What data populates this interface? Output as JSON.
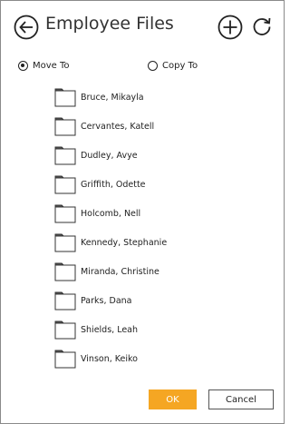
{
  "header": {
    "title": "Employee Files",
    "back_icon": "arrow-left-circle-icon",
    "add_icon": "plus-circle-icon",
    "refresh_icon": "refresh-icon"
  },
  "options": {
    "move_label": "Move To",
    "copy_label": "Copy To",
    "selected": "move"
  },
  "folders": [
    {
      "label": "Bruce, Mikayla"
    },
    {
      "label": "Cervantes, Katell"
    },
    {
      "label": "Dudley, Avye"
    },
    {
      "label": "Griffith, Odette"
    },
    {
      "label": "Holcomb, Nell"
    },
    {
      "label": "Kennedy, Stephanie"
    },
    {
      "label": "Miranda, Christine"
    },
    {
      "label": "Parks, Dana"
    },
    {
      "label": "Shields, Leah"
    },
    {
      "label": "Vinson, Keiko"
    }
  ],
  "footer": {
    "ok_label": "OK",
    "cancel_label": "Cancel"
  },
  "colors": {
    "accent": "#f5a623",
    "text": "#222222",
    "border": "#8a8a8a"
  }
}
